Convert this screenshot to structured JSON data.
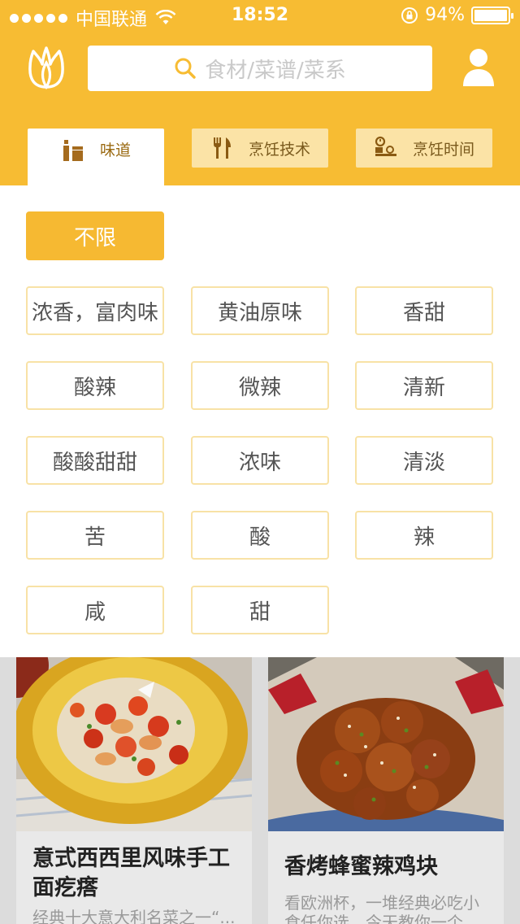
{
  "status_bar": {
    "carrier": "中国联通",
    "time": "18:52",
    "battery": "94%"
  },
  "header": {
    "search_placeholder": "食材/菜谱/菜系",
    "icons": {
      "logo": "tulip-logo-icon",
      "search": "search-icon",
      "user": "user-icon"
    }
  },
  "tabs": [
    {
      "label": "味道",
      "icon": "seasoning-bottles-icon",
      "active": true
    },
    {
      "label": "烹饪技术",
      "icon": "utensils-icon",
      "active": false
    },
    {
      "label": "烹饪时间",
      "icon": "timer-scale-icon",
      "active": false
    }
  ],
  "filters": {
    "selected": "不限",
    "options": [
      "不限",
      "浓香，富肉味",
      "黄油原味",
      "香甜",
      "酸辣",
      "微辣",
      "清新",
      "酸酸甜甜",
      "浓味",
      "清淡",
      "苦",
      "酸",
      "辣",
      "咸",
      "甜"
    ]
  },
  "recipes": [
    {
      "title": "意式西西里风味手工面疙瘩",
      "description": "经典十大意大利名菜之一“..."
    },
    {
      "title": "香烤蜂蜜辣鸡块",
      "description": "看欧洲杯，一堆经典必吃小食任你选，今天教你一个..."
    }
  ],
  "colors": {
    "brand": "#f7bc33",
    "tab_inactive": "#fbe3a6",
    "option_border": "#f8e2a6"
  }
}
